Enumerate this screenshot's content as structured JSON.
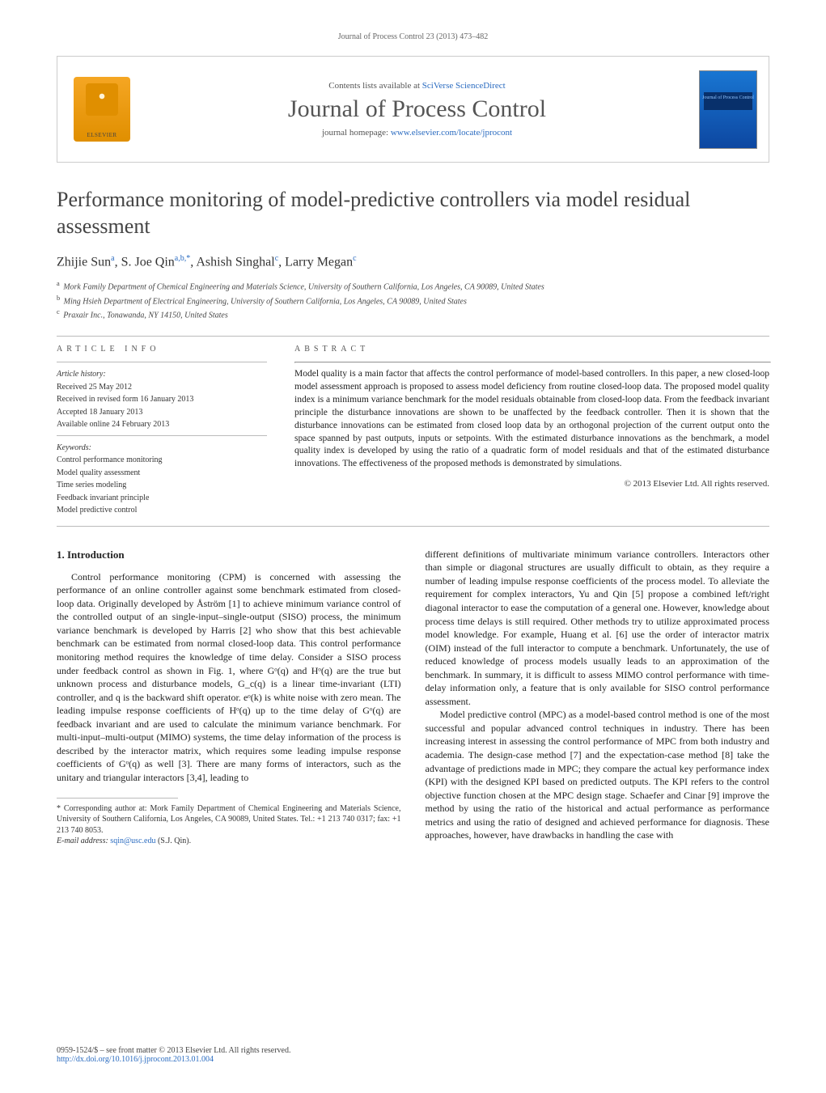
{
  "running_header": "Journal of Process Control 23 (2013) 473–482",
  "masthead": {
    "elsevier_label": "ELSEVIER",
    "contents_prefix": "Contents lists available at ",
    "contents_link_text": "SciVerse ScienceDirect",
    "journal_name": "Journal of Process Control",
    "homepage_prefix": "journal homepage: ",
    "homepage_link_text": "www.elsevier.com/locate/jprocont",
    "cover_text": "Journal of\nProcess Control"
  },
  "title": "Performance monitoring of model-predictive controllers via model residual assessment",
  "authors_html": "Zhijie Sun<sup>a</sup>, S. Joe Qin<sup>a,b,*</sup>, Ashish Singhal<sup>c</sup>, Larry Megan<sup>c</sup>",
  "affiliations": {
    "a": "Mork Family Department of Chemical Engineering and Materials Science, University of Southern California, Los Angeles, CA 90089, United States",
    "b": "Ming Hsieh Department of Electrical Engineering, University of Southern California, Los Angeles, CA 90089, United States",
    "c": "Praxair Inc., Tonawanda, NY 14150, United States"
  },
  "article_info": {
    "heading": "article info",
    "history_label": "Article history:",
    "received": "Received 25 May 2012",
    "revised": "Received in revised form 16 January 2013",
    "accepted": "Accepted 18 January 2013",
    "online": "Available online 24 February 2013",
    "keywords_label": "Keywords:",
    "keywords": [
      "Control performance monitoring",
      "Model quality assessment",
      "Time series modeling",
      "Feedback invariant principle",
      "Model predictive control"
    ]
  },
  "abstract": {
    "heading": "abstract",
    "text": "Model quality is a main factor that affects the control performance of model-based controllers. In this paper, a new closed-loop model assessment approach is proposed to assess model deficiency from routine closed-loop data. The proposed model quality index is a minimum variance benchmark for the model residuals obtainable from closed-loop data. From the feedback invariant principle the disturbance innovations are shown to be unaffected by the feedback controller. Then it is shown that the disturbance innovations can be estimated from closed loop data by an orthogonal projection of the current output onto the space spanned by past outputs, inputs or setpoints. With the estimated disturbance innovations as the benchmark, a model quality index is developed by using the ratio of a quadratic form of model residuals and that of the estimated disturbance innovations. The effectiveness of the proposed methods is demonstrated by simulations.",
    "copyright": "© 2013 Elsevier Ltd. All rights reserved."
  },
  "body": {
    "section1_heading": "1. Introduction",
    "para1": "Control performance monitoring (CPM) is concerned with assessing the performance of an online controller against some benchmark estimated from closed-loop data. Originally developed by Åström [1] to achieve minimum variance control of the controlled output of an single-input–single-output (SISO) process, the minimum variance benchmark is developed by Harris [2] who show that this best achievable benchmark can be estimated from normal closed-loop data. This control performance monitoring method requires the knowledge of time delay. Consider a SISO process under feedback control as shown in Fig. 1, where Gᵒ(q) and Hᵒ(q) are the true but unknown process and disturbance models, G_c(q) is a linear time-invariant (LTI) controller, and q is the backward shift operator. eᵒ(k) is white noise with zero mean. The leading impulse response coefficients of Hᵒ(q) up to the time delay of Gᵒ(q) are feedback invariant and are used to calculate the minimum variance benchmark. For multi-input–multi-output (MIMO) systems, the time delay information of the process is described by the interactor matrix, which requires some leading impulse response coefficients of Gᵒ(q) as well [3]. There are many forms of interactors, such as the unitary and triangular interactors [3,4], leading to",
    "para2": "different definitions of multivariate minimum variance controllers. Interactors other than simple or diagonal structures are usually difficult to obtain, as they require a number of leading impulse response coefficients of the process model. To alleviate the requirement for complex interactors, Yu and Qin [5] propose a combined left/right diagonal interactor to ease the computation of a general one. However, knowledge about process time delays is still required. Other methods try to utilize approximated process model knowledge. For example, Huang et al. [6] use the order of interactor matrix (OIM) instead of the full interactor to compute a benchmark. Unfortunately, the use of reduced knowledge of process models usually leads to an approximation of the benchmark. In summary, it is difficult to assess MIMO control performance with time-delay information only, a feature that is only available for SISO control performance assessment.",
    "para3": "Model predictive control (MPC) as a model-based control method is one of the most successful and popular advanced control techniques in industry. There has been increasing interest in assessing the control performance of MPC from both industry and academia. The design-case method [7] and the expectation-case method [8] take the advantage of predictions made in MPC; they compare the actual key performance index (KPI) with the designed KPI based on predicted outputs. The KPI refers to the control objective function chosen at the MPC design stage. Schaefer and Cinar [9] improve the method by using the ratio of the historical and actual performance as performance metrics and using the ratio of designed and achieved performance for diagnosis. These approaches, however, have drawbacks in handling the case with"
  },
  "footnote": {
    "corresponding": "* Corresponding author at: Mork Family Department of Chemical Engineering and Materials Science, University of Southern California, Los Angeles, CA 90089, United States. Tel.: +1 213 740 0317; fax: +1 213 740 8053.",
    "email_label": "E-mail address: ",
    "email": "sqin@usc.edu",
    "email_attribution": " (S.J. Qin)."
  },
  "bottom": {
    "issn_line": "0959-1524/$ – see front matter © 2013 Elsevier Ltd. All rights reserved.",
    "doi_label": "http://dx.doi.org/",
    "doi_value": "10.1016/j.jprocont.2013.01.004"
  }
}
